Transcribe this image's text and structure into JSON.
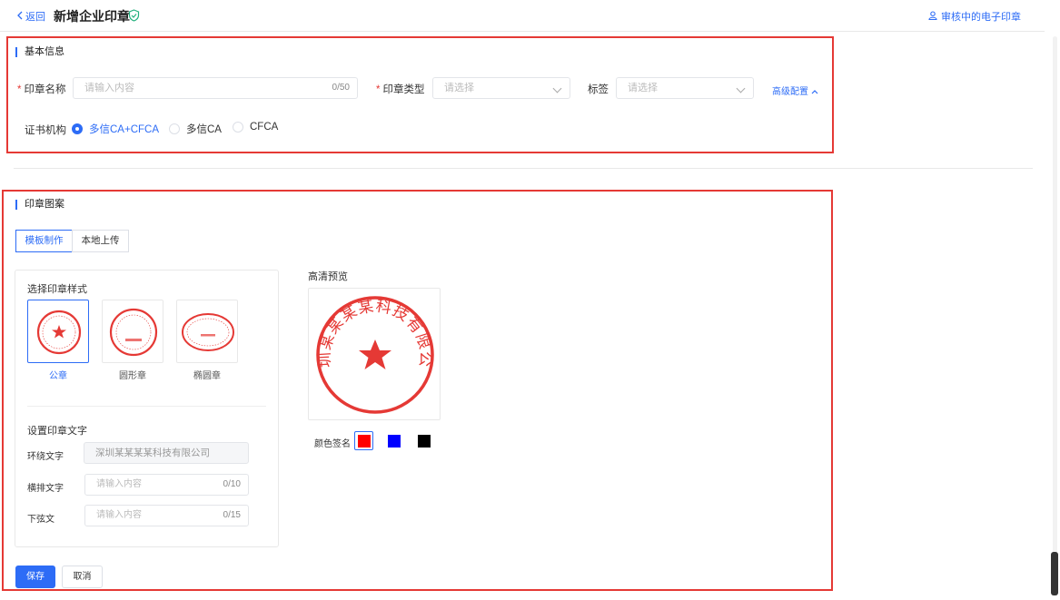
{
  "header": {
    "back_label": "返回",
    "title": "新增企业印章",
    "reviewing_link": "审核中的电子印章"
  },
  "basic_info": {
    "section_title": "基本信息",
    "seal_name": {
      "label": "印章名称",
      "placeholder": "请输入内容",
      "counter": "0/50"
    },
    "seal_type": {
      "label": "印章类型",
      "placeholder": "请选择"
    },
    "tag": {
      "label": "标签",
      "placeholder": "请选择"
    },
    "advanced_label": "高级配置",
    "cert_authority": {
      "label": "证书机构",
      "options": [
        {
          "label": "多信CA+CFCA",
          "selected": true
        },
        {
          "label": "多信CA",
          "selected": false
        },
        {
          "label": "CFCA",
          "selected": false
        }
      ]
    }
  },
  "seal_pattern": {
    "section_title": "印章图案",
    "tabs": [
      {
        "label": "模板制作",
        "active": true
      },
      {
        "label": "本地上传",
        "active": false
      }
    ],
    "select_style_title": "选择印章样式",
    "styles": [
      {
        "label": "公章",
        "selected": true
      },
      {
        "label": "圆形章",
        "selected": false
      },
      {
        "label": "椭圆章",
        "selected": false
      }
    ],
    "set_text_title": "设置印章文字",
    "ring_text": {
      "label": "环绕文字",
      "value": "深圳某某某某科技有限公司"
    },
    "horizontal_text": {
      "label": "横排文字",
      "placeholder": "请输入内容",
      "counter": "0/10"
    },
    "bottom_text": {
      "label": "下弦文",
      "placeholder": "请输入内容",
      "counter": "0/15"
    },
    "preview_title": "高清预览",
    "preview_text": "深圳某某某某科技有限公司",
    "color_label": "颜色签名",
    "colors": [
      "#ff0000",
      "#0000ff",
      "#000000"
    ],
    "selected_color": "#ff0000"
  },
  "actions": {
    "save_label": "保存",
    "cancel_label": "取消"
  }
}
